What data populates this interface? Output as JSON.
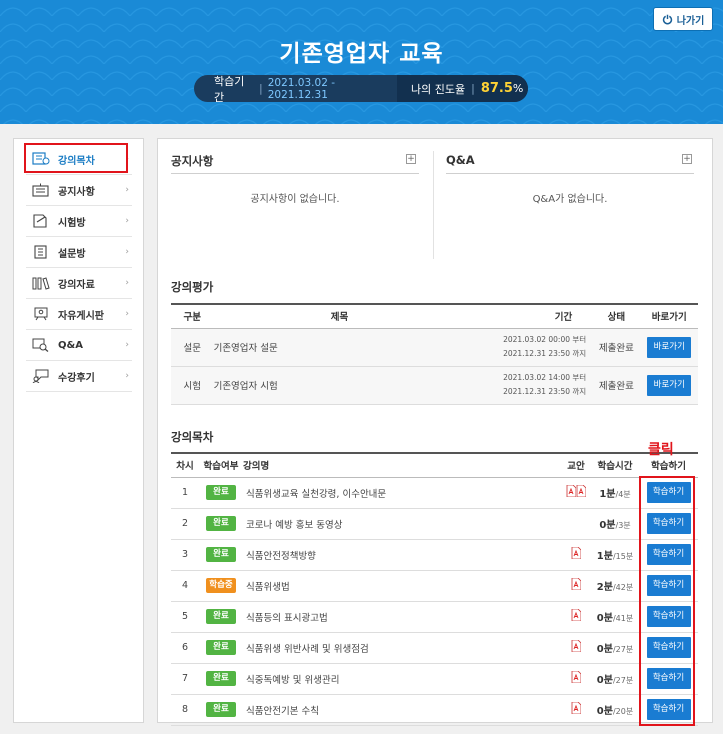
{
  "header": {
    "title": "기존영업자 교육",
    "exit_label": "나가기",
    "period_label": "학습기간",
    "period_value": "2021.03.02 - 2021.12.31",
    "progress_label": "나의 진도율",
    "progress_value": "87.5",
    "progress_unit": "%"
  },
  "sidebar": {
    "items": [
      {
        "label": "강의목차",
        "icon": "lecture-list-icon"
      },
      {
        "label": "공지사항",
        "icon": "notice-icon"
      },
      {
        "label": "시험방",
        "icon": "exam-icon"
      },
      {
        "label": "설문방",
        "icon": "survey-icon"
      },
      {
        "label": "강의자료",
        "icon": "materials-icon"
      },
      {
        "label": "자유게시판",
        "icon": "board-icon"
      },
      {
        "label": "Q&A",
        "icon": "qna-icon"
      },
      {
        "label": "수강후기",
        "icon": "review-icon"
      }
    ]
  },
  "notice": {
    "title": "공지사항",
    "empty": "공지사항이 없습니다."
  },
  "qna": {
    "title": "Q&A",
    "empty": "Q&A가 없습니다."
  },
  "evaluation": {
    "title": "강의평가",
    "headers": [
      "구분",
      "제목",
      "기간",
      "상태",
      "바로가기"
    ],
    "rows": [
      {
        "type": "설문",
        "name": "기존영업자 설문",
        "period1": "2021.03.02 00:00 부터",
        "period2": "2021.12.31 23:50 까지",
        "status": "제출완료",
        "button": "바로가기"
      },
      {
        "type": "시험",
        "name": "기존영업자 시험",
        "period1": "2021.03.02 14:00 부터",
        "period2": "2021.12.31 23:50 까지",
        "status": "제출완료",
        "button": "바로가기"
      }
    ]
  },
  "toc": {
    "title": "강의목차",
    "headers": [
      "차시",
      "학습여부",
      "강의명",
      "교안",
      "학습시간",
      "학습하기"
    ],
    "rows": [
      {
        "no": "1",
        "state": "완료",
        "state_type": "done",
        "name": "식품위생교육 실천강령, 이수안내문",
        "pdf": 2,
        "time": "1분",
        "total": "/4분",
        "button": "학습하기"
      },
      {
        "no": "2",
        "state": "완료",
        "state_type": "done",
        "name": "코로나 예방 홍보 동영상",
        "pdf": 0,
        "time": "0분",
        "total": "/3분",
        "button": "학습하기"
      },
      {
        "no": "3",
        "state": "완료",
        "state_type": "done",
        "name": "식품안전정책방향",
        "pdf": 1,
        "time": "1분",
        "total": "/15분",
        "button": "학습하기"
      },
      {
        "no": "4",
        "state": "학습중",
        "state_type": "prog",
        "name": "식품위생법",
        "pdf": 1,
        "time": "2분",
        "total": "/42분",
        "button": "학습하기"
      },
      {
        "no": "5",
        "state": "완료",
        "state_type": "done",
        "name": "식품등의 표시광고법",
        "pdf": 1,
        "time": "0분",
        "total": "/41분",
        "button": "학습하기"
      },
      {
        "no": "6",
        "state": "완료",
        "state_type": "done",
        "name": "식품위생 위반사례 및 위생점검",
        "pdf": 1,
        "time": "0분",
        "total": "/27분",
        "button": "학습하기"
      },
      {
        "no": "7",
        "state": "완료",
        "state_type": "done",
        "name": "식중독예방 및 위생관리",
        "pdf": 1,
        "time": "0분",
        "total": "/27분",
        "button": "학습하기"
      },
      {
        "no": "8",
        "state": "완료",
        "state_type": "done",
        "name": "식품안전기본 수칙",
        "pdf": 1,
        "time": "0분",
        "total": "/20분",
        "button": "학습하기"
      }
    ]
  },
  "annotation": {
    "click_label": "클릭"
  }
}
